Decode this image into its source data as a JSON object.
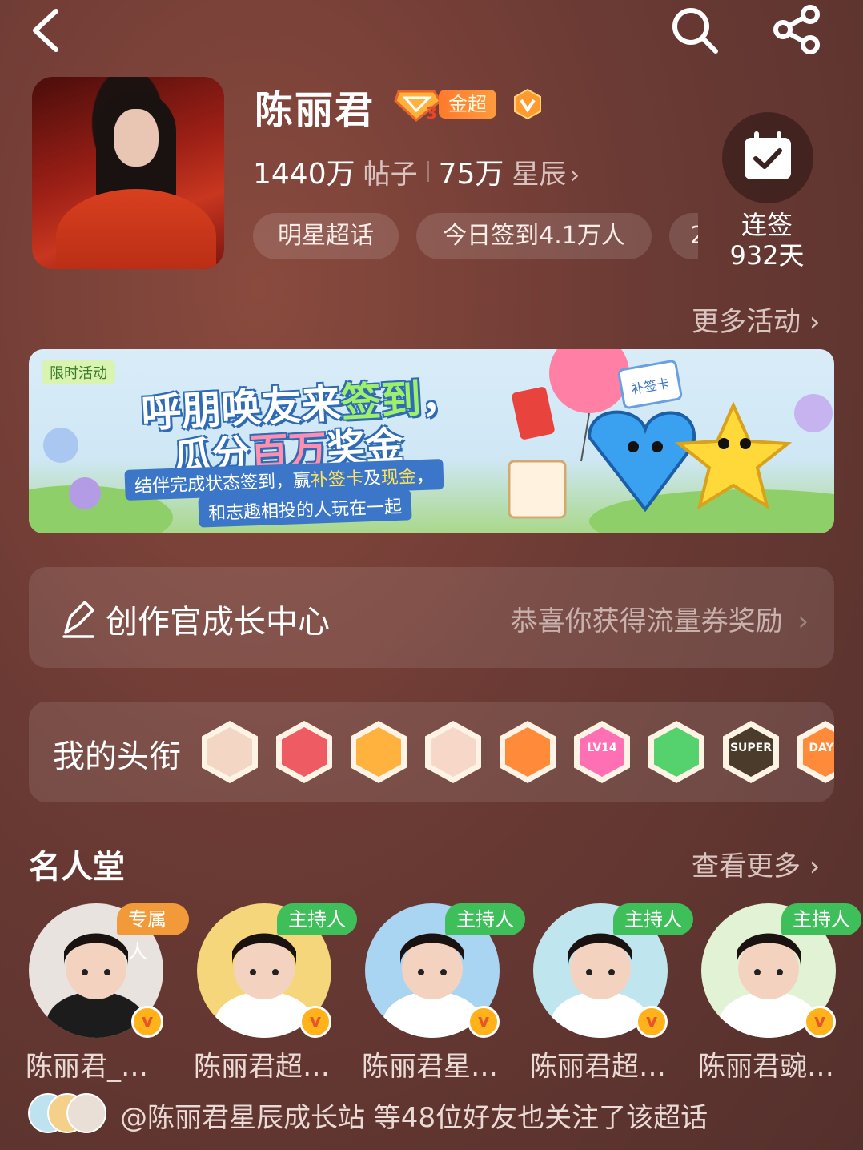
{
  "header": {
    "back_icon": "chevron-left-icon",
    "search_icon": "search-icon",
    "share_icon": "share-icon"
  },
  "profile": {
    "name": "陈丽君",
    "badge_level": "3",
    "badge_label": "金超",
    "verified_icon": "v-badge-icon",
    "posts_count": "1440万",
    "posts_label": "帖子",
    "stars_count": "75万",
    "stars_label": "星辰",
    "stars_chevron": "›",
    "tags": [
      "明星超话",
      "今日签到4.1万人",
      "2"
    ]
  },
  "checkin": {
    "icon": "calendar-check-icon",
    "label": "连签",
    "days": "932天"
  },
  "more_activities": "更多活动 ›",
  "banner": {
    "tag": "限时活动",
    "line1_a": "呼朋唤友来",
    "line1_b": "签到",
    "line1_c": "，",
    "line2_a": "瓜分",
    "line2_b": "百万",
    "line2_c": "奖金",
    "sub1_a": "结伴完成状态签到，赢",
    "sub1_b": "补签卡",
    "sub1_c": "及",
    "sub1_d": "现金",
    "sub1_e": "，",
    "sub2": "和志趣相投的人玩在一起",
    "card_label": "补签卡"
  },
  "creator_center": {
    "icon": "pen-icon",
    "title": "创作官成长中心",
    "reward_text": "恭喜你获得流量券奖励",
    "chevron": "›"
  },
  "my_titles": {
    "label": "我的头衔",
    "badges": [
      {
        "icon": "rabbit-badge-icon",
        "color": "#f3d6c4",
        "text": ""
      },
      {
        "icon": "trophy-badge-icon",
        "color": "#ef5b63",
        "text": ""
      },
      {
        "icon": "crown-badge-icon",
        "color": "#ffb23e",
        "text": ""
      },
      {
        "icon": "rabbit-red-badge-icon",
        "color": "#f6d7c8",
        "text": ""
      },
      {
        "icon": "dragon-badge-icon",
        "color": "#ff8a3a",
        "text": ""
      },
      {
        "icon": "level-badge-icon",
        "color": "#ff6fb3",
        "text": "LV14"
      },
      {
        "icon": "hand-badge-icon",
        "color": "#55d26d",
        "text": ""
      },
      {
        "icon": "super-badge-icon",
        "color": "#4a3b2a",
        "text": "SUPER"
      },
      {
        "icon": "days-badge-icon",
        "color": "#ff8a3a",
        "text": "DAYS"
      }
    ]
  },
  "hall_of_fame": {
    "title": "名人堂",
    "more": "查看更多 ›",
    "members": [
      {
        "role": "专属人",
        "role_color": "#f29a3a",
        "name": "陈丽君_…",
        "bg": "#e9e3df"
      },
      {
        "role": "主持人",
        "role_color": "#3fbf5a",
        "name": "陈丽君超…",
        "bg": "#f6d67a"
      },
      {
        "role": "主持人",
        "role_color": "#3fbf5a",
        "name": "陈丽君星…",
        "bg": "#a9d4f2"
      },
      {
        "role": "主持人",
        "role_color": "#3fbf5a",
        "name": "陈丽君超…",
        "bg": "#bfe6ee"
      },
      {
        "role": "主持人",
        "role_color": "#3fbf5a",
        "name": "陈丽君豌…",
        "bg": "#e2f3d5"
      }
    ]
  },
  "footer": {
    "text": "@陈丽君星辰成长站 等48位好友也关注了该超话"
  }
}
